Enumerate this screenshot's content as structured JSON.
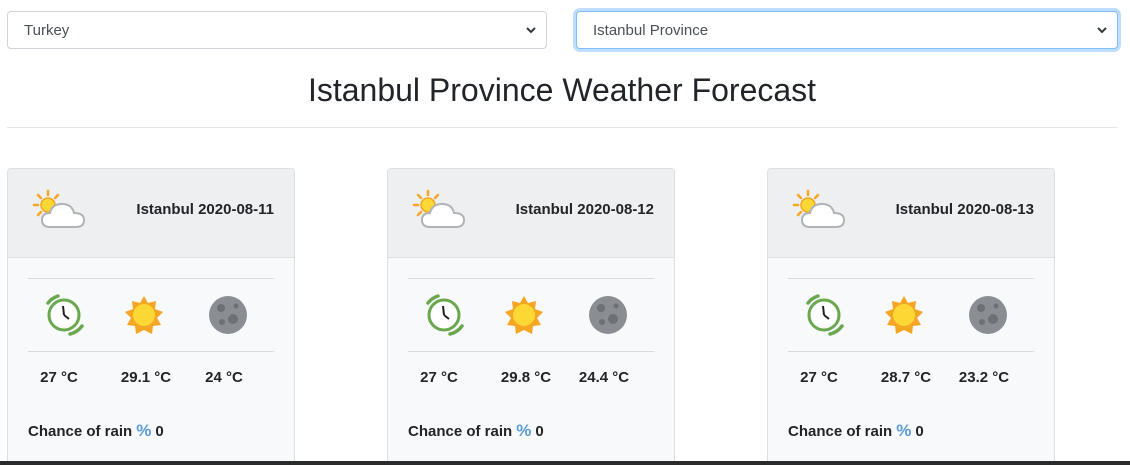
{
  "selects": {
    "country": "Turkey",
    "province": "Istanbul Province"
  },
  "title": "Istanbul Province Weather Forecast",
  "cards": [
    {
      "city_date": "Istanbul 2020-08-11",
      "temp_now": "27 °C",
      "temp_day": "29.1 °C",
      "temp_night": "24 °C",
      "rain_label": "Chance of rain",
      "rain_symbol": "%",
      "rain_value": "0"
    },
    {
      "city_date": "Istanbul 2020-08-12",
      "temp_now": "27 °C",
      "temp_day": "29.8 °C",
      "temp_night": "24.4 °C",
      "rain_label": "Chance of rain",
      "rain_symbol": "%",
      "rain_value": "0"
    },
    {
      "city_date": "Istanbul 2020-08-13",
      "temp_now": "27 °C",
      "temp_day": "28.7 °C",
      "temp_night": "23.2 °C",
      "rain_label": "Chance of rain",
      "rain_symbol": "%",
      "rain_value": "0"
    }
  ],
  "icons": {
    "header": "partly-cloudy-icon",
    "now": "clock-icon",
    "day": "sun-icon",
    "night": "moon-icon",
    "dropdown": "chevron-down-icon"
  },
  "colors": {
    "focus_border": "#80bdff",
    "clock_green": "#6aa84f",
    "sun_orange": "#f5a623",
    "rain_blue": "#5b9bd5"
  }
}
